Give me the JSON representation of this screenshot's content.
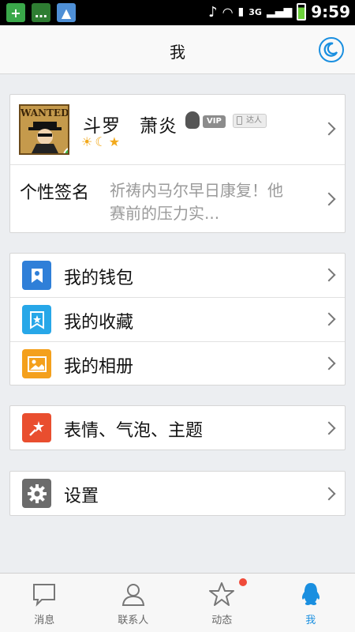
{
  "status_bar": {
    "time": "9:59",
    "network": "3G"
  },
  "header": {
    "title": "我"
  },
  "profile": {
    "avatar_text": "WANTED",
    "nickname": "斗罗　萧炎",
    "vip_label": "VIP",
    "talent_label": "达人",
    "signature_label": "个性签名",
    "signature_text": "祈祷内马尔早日康复！他赛前的压力实..."
  },
  "menu_group_1": [
    {
      "label": "我的钱包",
      "icon": "wallet-icon",
      "color": "#2f7fd8"
    },
    {
      "label": "我的收藏",
      "icon": "favorites-icon",
      "color": "#27a7e8"
    },
    {
      "label": "我的相册",
      "icon": "album-icon",
      "color": "#f4a01c"
    }
  ],
  "menu_group_2": [
    {
      "label": "表情、气泡、主题",
      "icon": "theme-icon",
      "color": "#e94e2f"
    }
  ],
  "menu_group_3": [
    {
      "label": "设置",
      "icon": "gear-icon",
      "color": "#6b6b6b"
    }
  ],
  "tabs": [
    {
      "label": "消息",
      "icon": "message-icon"
    },
    {
      "label": "联系人",
      "icon": "contacts-icon"
    },
    {
      "label": "动态",
      "icon": "star-icon",
      "badge": true
    },
    {
      "label": "我",
      "icon": "qq-penguin-icon",
      "active": true
    }
  ],
  "colors": {
    "accent": "#1a8fe0",
    "badge": "#f04b3a"
  }
}
